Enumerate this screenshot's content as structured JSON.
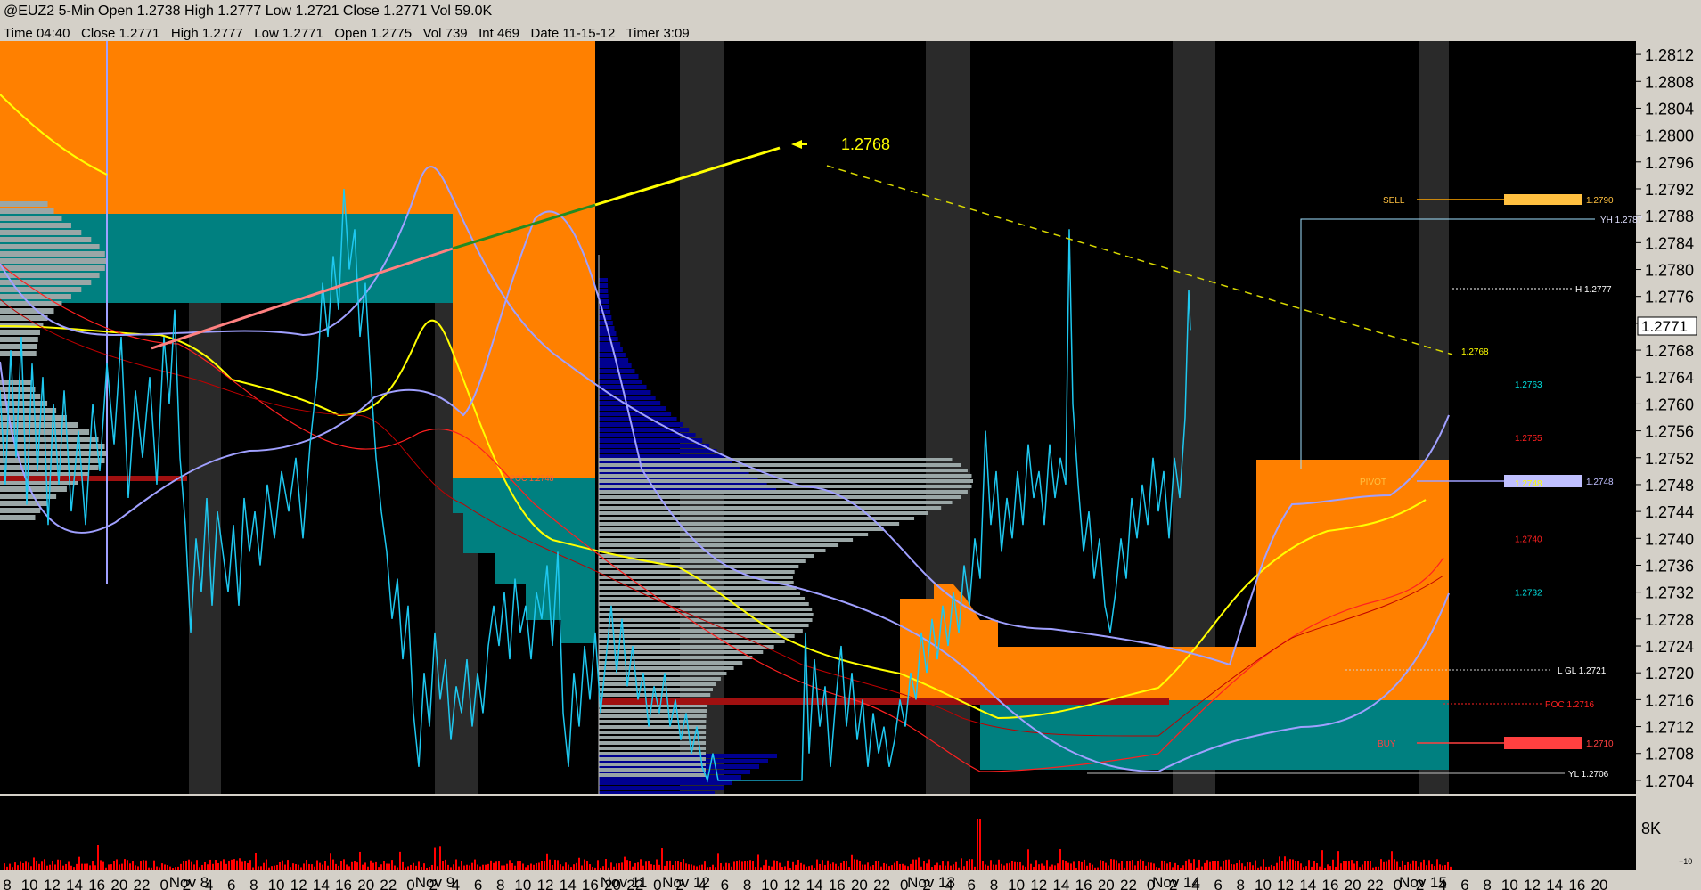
{
  "window": {
    "title": "@EUZ2 5-Min Open 1.2738 High 1.2777 Low 1.2721 Close 1.2771 Vol 59.0K",
    "info": "Time 04:40   Close 1.2771   High 1.2777   Low 1.2771   Open 1.2775   Vol 739   Int 469   Date 11-15-12   Timer 3:09"
  },
  "colors": {
    "background": "#000000",
    "price_line": "#1ec8f0",
    "orange_zone": "#ff8000",
    "teal_zone": "#008080",
    "volume_profile": "#9aa6a6",
    "navy_profile": "#000090",
    "yellow": "#ffff00",
    "lavender": "#a0a0ff",
    "red": "#ff0000",
    "volume_bars": "#ff0000"
  },
  "chart_data": {
    "type": "line",
    "title": "@EUZ2 5-Min",
    "price_axis": {
      "ylim": [
        1.2702,
        1.2814
      ],
      "ticks": [
        "1.2812",
        "1.2808",
        "1.2804",
        "1.2800",
        "1.2796",
        "1.2792",
        "1.2788",
        "1.2784",
        "1.2780",
        "1.2776",
        "1.2772",
        "1.2768",
        "1.2764",
        "1.2760",
        "1.2756",
        "1.2752",
        "1.2748",
        "1.2744",
        "1.2740",
        "1.2736",
        "1.2732",
        "1.2728",
        "1.2724",
        "1.2720",
        "1.2716",
        "1.2712",
        "1.2708",
        "1.2704"
      ],
      "last_price": "1.2771"
    },
    "volume_axis": {
      "label": "8K",
      "corner": "+10"
    },
    "time_axis": {
      "ticks": [
        "8",
        "10",
        "12",
        "14",
        "16",
        "20",
        "22",
        "0",
        "2",
        "4",
        "6",
        "8",
        "10",
        "12",
        "14",
        "16",
        "20",
        "22",
        "0",
        "2",
        "4",
        "6",
        "8",
        "10",
        "12",
        "14",
        "16",
        "20",
        "22",
        "0",
        "2",
        "4",
        "6",
        "8",
        "10",
        "12",
        "14",
        "16",
        "20",
        "22",
        "0",
        "2",
        "4",
        "6",
        "8",
        "10",
        "12",
        "14",
        "16",
        "20",
        "22",
        "0",
        "2",
        "4",
        "6",
        "8",
        "10",
        "12",
        "14",
        "16",
        "20",
        "22",
        "0",
        "2",
        "4",
        "6",
        "8",
        "10",
        "12",
        "14",
        "16",
        "20"
      ],
      "days": [
        "Nov 8",
        "Nov 9",
        "Nov 11",
        "Nov 12",
        "Nov 13",
        "Nov 14",
        "Nov 15"
      ]
    },
    "annotations": {
      "projection": "1.2768",
      "projection_small": "1.2768",
      "poc_mid": "POC 1.2748",
      "sell_label": "SELL",
      "sell_value": "1.2790",
      "yh": "YH 1.2787",
      "h": "H 1.2777",
      "pivot_label": "PIVOT",
      "pivot_value": "1.2748",
      "pivot_band_text": "1.2748",
      "l_gl": "L GL 1.2721",
      "poc": "POC 1.2716",
      "buy_label": "BUY",
      "buy_value": "1.2710",
      "yl": "YL 1.2706",
      "levels": [
        {
          "value": "1.2763",
          "color": "#00e0e0",
          "price": 1.2763
        },
        {
          "value": "1.2755",
          "color": "#ff2020",
          "price": 1.2755
        },
        {
          "value": "1.2740",
          "color": "#ff2020",
          "price": 1.274
        },
        {
          "value": "1.2732",
          "color": "#00e0e0",
          "price": 1.2732
        }
      ]
    },
    "price_path": [
      [
        0,
        1.2762
      ],
      [
        6,
        1.2748
      ],
      [
        12,
        1.2768
      ],
      [
        18,
        1.2752
      ],
      [
        24,
        1.277
      ],
      [
        30,
        1.2745
      ],
      [
        36,
        1.2766
      ],
      [
        42,
        1.275
      ],
      [
        48,
        1.2764
      ],
      [
        54,
        1.2742
      ],
      [
        60,
        1.276
      ],
      [
        66,
        1.2748
      ],
      [
        72,
        1.2762
      ],
      [
        80,
        1.2744
      ],
      [
        88,
        1.2756
      ],
      [
        96,
        1.2742
      ],
      [
        104,
        1.276
      ],
      [
        112,
        1.275
      ],
      [
        120,
        1.2766
      ],
      [
        128,
        1.2754
      ],
      [
        136,
        1.277
      ],
      [
        144,
        1.2746
      ],
      [
        152,
        1.2762
      ],
      [
        160,
        1.2752
      ],
      [
        168,
        1.2764
      ],
      [
        176,
        1.2748
      ],
      [
        184,
        1.277
      ],
      [
        190,
        1.276
      ],
      [
        196,
        1.2774
      ],
      [
        202,
        1.2752
      ],
      [
        208,
        1.2742
      ],
      [
        214,
        1.2726
      ],
      [
        220,
        1.274
      ],
      [
        226,
        1.2732
      ],
      [
        232,
        1.2746
      ],
      [
        238,
        1.273
      ],
      [
        244,
        1.2744
      ],
      [
        250,
        1.2738
      ],
      [
        256,
        1.2732
      ],
      [
        262,
        1.2742
      ],
      [
        268,
        1.273
      ],
      [
        274,
        1.2746
      ],
      [
        280,
        1.2738
      ],
      [
        286,
        1.2744
      ],
      [
        292,
        1.2736
      ],
      [
        300,
        1.2748
      ],
      [
        308,
        1.274
      ],
      [
        316,
        1.275
      ],
      [
        324,
        1.2744
      ],
      [
        332,
        1.2752
      ],
      [
        340,
        1.274
      ],
      [
        348,
        1.2754
      ],
      [
        356,
        1.2764
      ],
      [
        362,
        1.2778
      ],
      [
        368,
        1.277
      ],
      [
        374,
        1.2782
      ],
      [
        380,
        1.2774
      ],
      [
        386,
        1.2792
      ],
      [
        392,
        1.278
      ],
      [
        398,
        1.2786
      ],
      [
        404,
        1.277
      ],
      [
        410,
        1.2778
      ],
      [
        416,
        1.2764
      ],
      [
        422,
        1.2752
      ],
      [
        428,
        1.2744
      ],
      [
        434,
        1.2738
      ],
      [
        440,
        1.2728
      ],
      [
        446,
        1.2734
      ],
      [
        452,
        1.2722
      ],
      [
        458,
        1.273
      ],
      [
        464,
        1.2714
      ],
      [
        470,
        1.2706
      ],
      [
        476,
        1.272
      ],
      [
        482,
        1.2712
      ],
      [
        488,
        1.2726
      ],
      [
        494,
        1.2716
      ],
      [
        500,
        1.2722
      ],
      [
        506,
        1.271
      ],
      [
        512,
        1.2718
      ],
      [
        518,
        1.2714
      ],
      [
        524,
        1.2722
      ],
      [
        530,
        1.2712
      ],
      [
        536,
        1.272
      ],
      [
        542,
        1.2714
      ],
      [
        548,
        1.2724
      ],
      [
        554,
        1.273
      ],
      [
        560,
        1.2724
      ],
      [
        566,
        1.2732
      ],
      [
        572,
        1.2722
      ],
      [
        578,
        1.2734
      ],
      [
        584,
        1.2726
      ],
      [
        590,
        1.273
      ],
      [
        596,
        1.2722
      ],
      [
        602,
        1.2732
      ],
      [
        608,
        1.2728
      ],
      [
        614,
        1.2736
      ],
      [
        620,
        1.2724
      ],
      [
        626,
        1.2738
      ],
      [
        632,
        1.2714
      ],
      [
        638,
        1.2706
      ],
      [
        644,
        1.272
      ],
      [
        650,
        1.2712
      ],
      [
        656,
        1.2724
      ],
      [
        662,
        1.2716
      ],
      [
        668,
        1.2726
      ],
      [
        674,
        1.2714
      ],
      [
        680,
        1.2722
      ],
      [
        686,
        1.273
      ],
      [
        692,
        1.272
      ],
      [
        698,
        1.2728
      ],
      [
        704,
        1.2718
      ],
      [
        710,
        1.2724
      ],
      [
        716,
        1.2716
      ],
      [
        722,
        1.272
      ],
      [
        728,
        1.2712
      ],
      [
        734,
        1.2718
      ],
      [
        740,
        1.2714
      ],
      [
        746,
        1.272
      ],
      [
        752,
        1.2712
      ],
      [
        758,
        1.2716
      ],
      [
        764,
        1.271
      ],
      [
        770,
        1.2714
      ],
      [
        776,
        1.2708
      ],
      [
        782,
        1.2712
      ],
      [
        788,
        1.2706
      ],
      [
        794,
        1.2704
      ],
      [
        800,
        1.2708
      ],
      [
        806,
        1.2704
      ],
      [
        900,
        1.2704
      ],
      [
        904,
        1.2726
      ],
      [
        908,
        1.2708
      ],
      [
        914,
        1.2722
      ],
      [
        920,
        1.2712
      ],
      [
        926,
        1.2718
      ],
      [
        932,
        1.2706
      ],
      [
        938,
        1.2716
      ],
      [
        944,
        1.2724
      ],
      [
        950,
        1.2712
      ],
      [
        956,
        1.272
      ],
      [
        962,
        1.271
      ],
      [
        968,
        1.2716
      ],
      [
        974,
        1.2706
      ],
      [
        980,
        1.2714
      ],
      [
        986,
        1.2708
      ],
      [
        992,
        1.2712
      ],
      [
        998,
        1.2706
      ],
      [
        1004,
        1.271
      ],
      [
        1010,
        1.2716
      ],
      [
        1016,
        1.2712
      ],
      [
        1022,
        1.272
      ],
      [
        1028,
        1.2716
      ],
      [
        1034,
        1.2726
      ],
      [
        1040,
        1.272
      ],
      [
        1046,
        1.2728
      ],
      [
        1052,
        1.2722
      ],
      [
        1058,
        1.273
      ],
      [
        1064,
        1.2724
      ],
      [
        1070,
        1.2732
      ],
      [
        1076,
        1.2726
      ],
      [
        1082,
        1.2736
      ],
      [
        1088,
        1.273
      ],
      [
        1094,
        1.274
      ],
      [
        1100,
        1.2734
      ],
      [
        1106,
        1.2756
      ],
      [
        1112,
        1.2742
      ],
      [
        1118,
        1.275
      ],
      [
        1124,
        1.2738
      ],
      [
        1130,
        1.2746
      ],
      [
        1136,
        1.274
      ],
      [
        1142,
        1.275
      ],
      [
        1148,
        1.2742
      ],
      [
        1154,
        1.2754
      ],
      [
        1160,
        1.2746
      ],
      [
        1166,
        1.275
      ],
      [
        1172,
        1.2742
      ],
      [
        1178,
        1.2754
      ],
      [
        1184,
        1.2746
      ],
      [
        1190,
        1.2752
      ],
      [
        1196,
        1.2748
      ],
      [
        1200,
        1.2786
      ],
      [
        1204,
        1.276
      ],
      [
        1210,
        1.2748
      ],
      [
        1216,
        1.2738
      ],
      [
        1222,
        1.2744
      ],
      [
        1228,
        1.2734
      ],
      [
        1234,
        1.274
      ],
      [
        1240,
        1.273
      ],
      [
        1246,
        1.2726
      ],
      [
        1252,
        1.2732
      ],
      [
        1258,
        1.274
      ],
      [
        1264,
        1.2734
      ],
      [
        1270,
        1.2746
      ],
      [
        1276,
        1.274
      ],
      [
        1282,
        1.2748
      ],
      [
        1288,
        1.2742
      ],
      [
        1294,
        1.2752
      ],
      [
        1300,
        1.2744
      ],
      [
        1306,
        1.275
      ],
      [
        1312,
        1.274
      ],
      [
        1318,
        1.2752
      ],
      [
        1324,
        1.2746
      ],
      [
        1330,
        1.2758
      ],
      [
        1334,
        1.2777
      ],
      [
        1336,
        1.2771
      ]
    ]
  }
}
